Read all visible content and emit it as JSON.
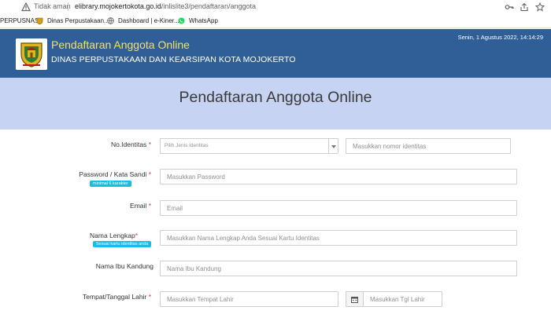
{
  "browser": {
    "security_label": "Tidak aman",
    "url_domain": "elibrary.mojokertokota.go.id",
    "url_path": "/inlislite3/pendaftaran/anggota"
  },
  "bookmarks": [
    {
      "label": "PERPUSNAS",
      "icon": "none"
    },
    {
      "label": "Dinas Perpustakaan...",
      "icon": "crest-icon"
    },
    {
      "label": "Dashboard | e-Kiner...",
      "icon": "globe-icon"
    },
    {
      "label": "WhatsApp",
      "icon": "whatsapp-icon"
    }
  ],
  "header": {
    "title": "Pendaftaran Anggota Online",
    "subtitle": "DINAS PERPUSTAKAAN DAN KEARSIPAN KOTA MOJOKERTO",
    "datetime": "Senin, 1 Agustus 2022, 14:14:29"
  },
  "banner": {
    "title": "Pendaftaran Anggota Online"
  },
  "form": {
    "identity": {
      "label": "No.Identitas",
      "required_mark": "*",
      "select_placeholder": "Pilih Jenis Identitas",
      "number_placeholder": "Masukkan nomor identitas"
    },
    "password": {
      "label": "Password / Kata Sandi",
      "required_mark": "*",
      "hint": "minimal 6 karakter",
      "placeholder": "Masukkan Password"
    },
    "email": {
      "label": "Email",
      "required_mark": "*",
      "placeholder": "Email"
    },
    "full_name": {
      "label": "Nama Lengkap",
      "required_mark": "*",
      "hint": "Sesuai kartu identitas anda",
      "placeholder": "Masukkan Nama Lengkap Anda Sesuai Kartu Identitas"
    },
    "mother_name": {
      "label": "Nama Ibu Kandung",
      "placeholder": "Nama Ibu Kandung"
    },
    "birth": {
      "label": "Tempat/Tanggal Lahir",
      "required_mark": "*",
      "place_placeholder": "Masukkan Tempat Lahir",
      "date_placeholder": "Masukkan Tgl Lahir"
    }
  },
  "colors": {
    "header_bg": "#2f5f96",
    "header_title": "#f6e25c",
    "banner_bg": "#c6d3f3",
    "hint_badge": "#18bde2",
    "required": "#e53935"
  }
}
